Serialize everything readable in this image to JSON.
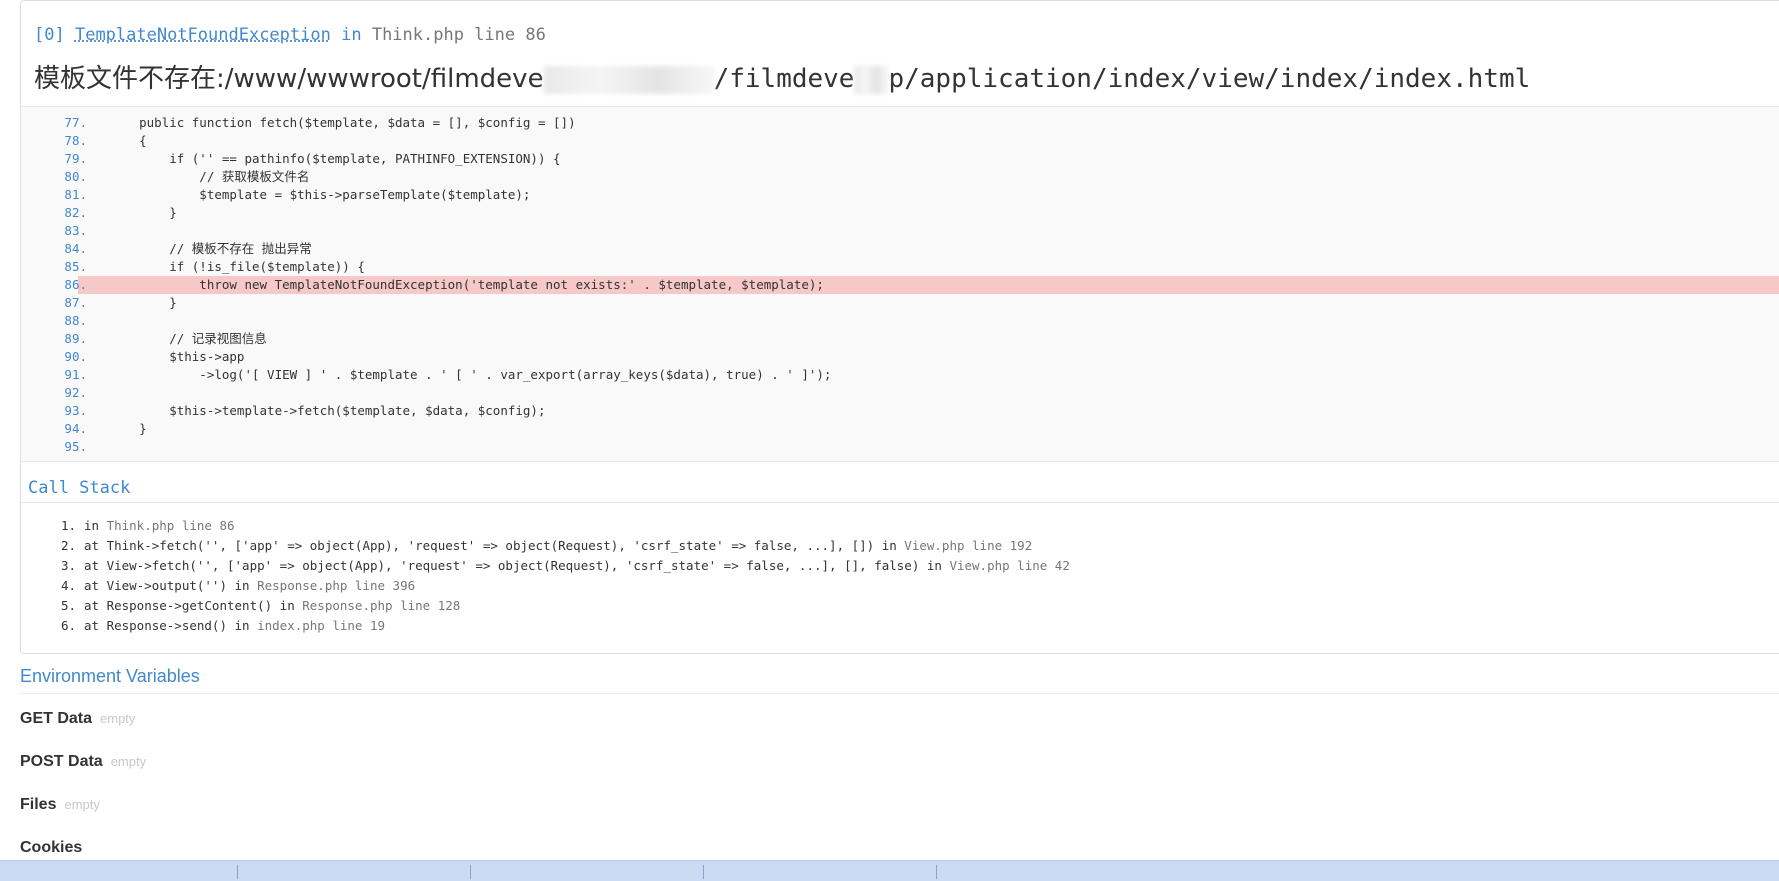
{
  "exception": {
    "index": "[0]",
    "class_name": "TemplateNotFoundException",
    "in_word": "in",
    "location": "Think.php line 86",
    "message_part1": "模板文件不存在:/www/wwwroot/filmdeve",
    "message_part2": "/filmdeve",
    "message_part3": "p/application/index/view/index/index.html"
  },
  "source": {
    "lines": [
      {
        "n": "77.",
        "code": "    public function fetch($template, $data = [], $config = [])"
      },
      {
        "n": "78.",
        "code": "    {"
      },
      {
        "n": "79.",
        "code": "        if ('' == pathinfo($template, PATHINFO_EXTENSION)) {"
      },
      {
        "n": "80.",
        "code": "            // 获取模板文件名"
      },
      {
        "n": "81.",
        "code": "            $template = $this->parseTemplate($template);"
      },
      {
        "n": "82.",
        "code": "        }"
      },
      {
        "n": "83.",
        "code": ""
      },
      {
        "n": "84.",
        "code": "        // 模板不存在 抛出异常"
      },
      {
        "n": "85.",
        "code": "        if (!is_file($template)) {"
      },
      {
        "n": "86.",
        "code": "            throw new TemplateNotFoundException('template not exists:' . $template, $template);"
      },
      {
        "n": "87.",
        "code": "        }"
      },
      {
        "n": "88.",
        "code": ""
      },
      {
        "n": "89.",
        "code": "        // 记录视图信息"
      },
      {
        "n": "90.",
        "code": "        $this->app"
      },
      {
        "n": "91.",
        "code": "            ->log('[ VIEW ] ' . $template . ' [ ' . var_export(array_keys($data), true) . ' ]');"
      },
      {
        "n": "92.",
        "code": ""
      },
      {
        "n": "93.",
        "code": "        $this->template->fetch($template, $data, $config);"
      },
      {
        "n": "94.",
        "code": "    }"
      },
      {
        "n": "95.",
        "code": ""
      }
    ]
  },
  "callstack": {
    "title": "Call Stack",
    "items": [
      {
        "num": "1.",
        "text": "in ",
        "file": "Think.php line 86"
      },
      {
        "num": "2.",
        "text": "at Think->fetch('', ['app' => object(App), 'request' => object(Request), 'csrf_state' => false, ...], []) in ",
        "file": "View.php line 192"
      },
      {
        "num": "3.",
        "text": "at View->fetch('', ['app' => object(App), 'request' => object(Request), 'csrf_state' => false, ...], [], false) in ",
        "file": "View.php line 42"
      },
      {
        "num": "4.",
        "text": "at View->output('') in ",
        "file": "Response.php line 396"
      },
      {
        "num": "5.",
        "text": "at Response->getContent() in ",
        "file": "Response.php line 128"
      },
      {
        "num": "6.",
        "text": "at Response->send() in ",
        "file": "index.php line 19"
      }
    ]
  },
  "environment": {
    "title": "Environment Variables",
    "sections": [
      {
        "label": "GET Data",
        "status": "empty"
      },
      {
        "label": "POST Data",
        "status": "empty"
      },
      {
        "label": "Files",
        "status": "empty"
      },
      {
        "label": "Cookies",
        "status": ""
      }
    ]
  },
  "colors": {
    "accent": "#4288ce",
    "highlight_line": "#f6c8c8",
    "taskbar": "#c9daf2"
  }
}
